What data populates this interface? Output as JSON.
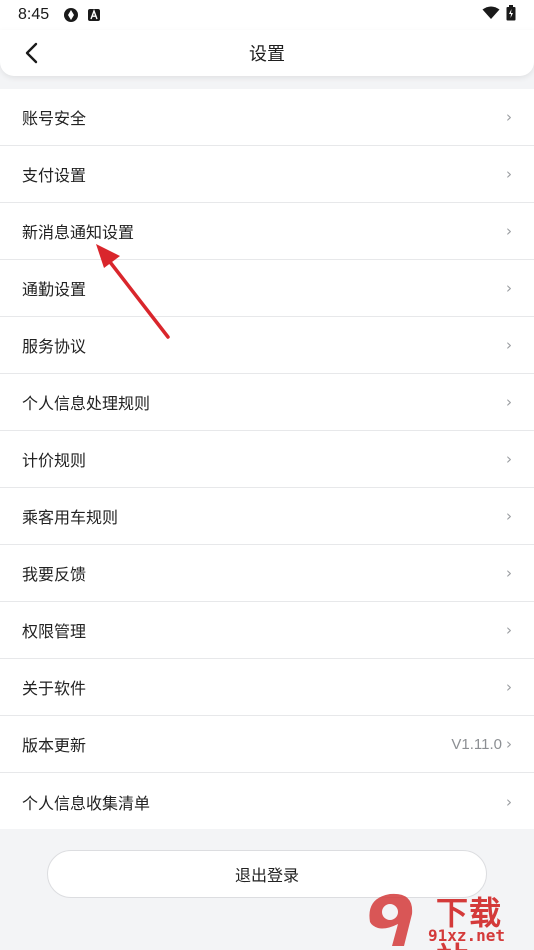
{
  "status_bar": {
    "time": "8:45"
  },
  "header": {
    "title": "设置"
  },
  "settings": [
    {
      "label": "账号安全",
      "value": ""
    },
    {
      "label": "支付设置",
      "value": ""
    },
    {
      "label": "新消息通知设置",
      "value": ""
    },
    {
      "label": "通勤设置",
      "value": ""
    },
    {
      "label": "服务协议",
      "value": ""
    },
    {
      "label": "个人信息处理规则",
      "value": ""
    },
    {
      "label": "计价规则",
      "value": ""
    },
    {
      "label": "乘客用车规则",
      "value": ""
    },
    {
      "label": "我要反馈",
      "value": ""
    },
    {
      "label": "权限管理",
      "value": ""
    },
    {
      "label": "关于软件",
      "value": ""
    },
    {
      "label": "版本更新",
      "value": "V1.11.0"
    },
    {
      "label": "个人信息收集清单",
      "value": ""
    }
  ],
  "chevron": "›",
  "logout": {
    "label": "退出登录"
  },
  "watermark": {
    "brand": "下载站",
    "domain": "91xz.net"
  },
  "colors": {
    "annotation_arrow": "#d9262c",
    "page_background": "#f3f4f6",
    "divider": "#e7e8ea"
  }
}
